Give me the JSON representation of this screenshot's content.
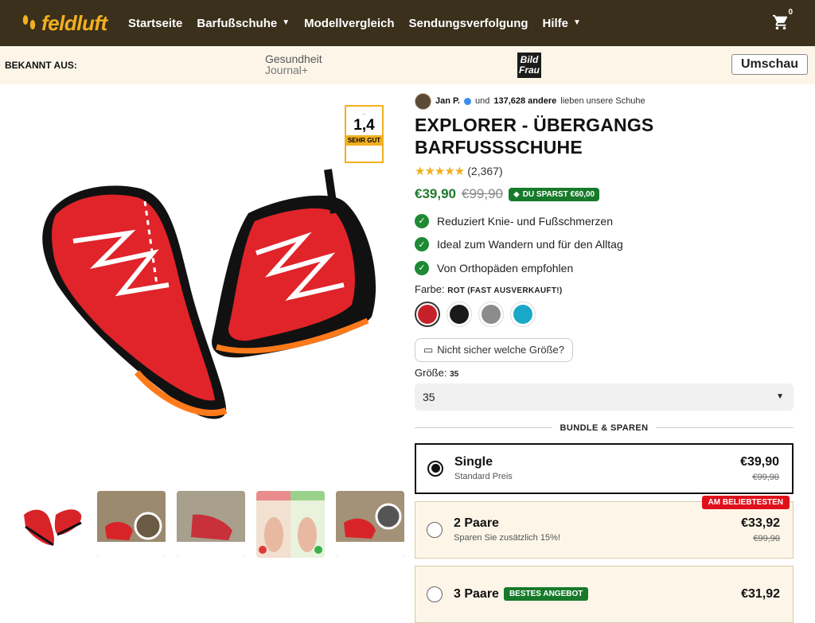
{
  "brand": {
    "name": "feldluft",
    "accent": "#f2b020",
    "header_bg": "#3a301b"
  },
  "nav": {
    "items": [
      {
        "label": "Startseite",
        "dropdown": false
      },
      {
        "label": "Barfußschuhe",
        "dropdown": true
      },
      {
        "label": "Modellvergleich",
        "dropdown": false
      },
      {
        "label": "Sendungsverfolgung",
        "dropdown": false
      },
      {
        "label": "Hilfe",
        "dropdown": true
      }
    ],
    "cart_count": "0",
    "cart_icon": "cart-icon"
  },
  "press": {
    "label": "BEKANNT AUS:",
    "logos": {
      "gesundheit_a": "Gesundheit",
      "gesundheit_b": "Journal+",
      "bild_a": "Bild",
      "bild_b": "Frau",
      "umschau": "Umschau"
    }
  },
  "gallery": {
    "seal_grade": "1,4",
    "seal_text": "SEHR GUT"
  },
  "product": {
    "social_user": "Jan P.",
    "social_and": "und",
    "social_count": "137,628 andere",
    "social_suffix": "lieben unsere Schuhe",
    "title": "EXPLORER - ÜBERGANGS BARFUSSSCHUHE",
    "stars": "★★★★★",
    "reviews": "(2,367)",
    "price": "€39,90",
    "old_price": "€99,90",
    "save_badge": "DU SPARST €60,00",
    "benefits": [
      "Reduziert Knie- und Fußschmerzen",
      "Ideal zum Wandern und für den Alltag",
      "Von Orthopäden empfohlen"
    ],
    "color_label": "Farbe:",
    "color_value": "ROT (FAST AUSVERKAUFT!)",
    "colors": [
      "#c8202a",
      "#1a1a1a",
      "#8c8c8c",
      "#1aa8c8"
    ],
    "size_help": "Nicht sicher welche Größe?",
    "size_label": "Größe:",
    "size_value": "35",
    "size_selected": "35",
    "bundle_heading": "BUNDLE & SPAREN",
    "bundles": [
      {
        "name": "Single",
        "sub": "Standard Preis",
        "price": "€39,90",
        "old": "€99,90"
      },
      {
        "name": "2 Paare",
        "sub": "Sparen Sie zusätzlich 15%!",
        "price": "€33,92",
        "old": "€99,90",
        "badge": "AM BELIEBTESTEN"
      },
      {
        "name": "3 Paare",
        "tag": "BESTES ANGEBOT",
        "price": "€31,92"
      }
    ]
  }
}
